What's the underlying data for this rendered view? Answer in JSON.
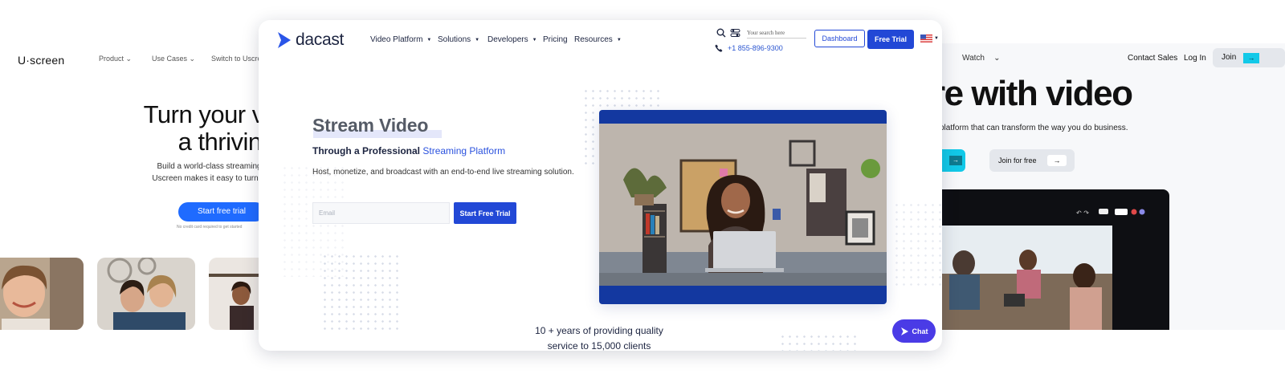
{
  "left_site": {
    "logo": "U·screen",
    "nav": [
      "Product",
      "Use Cases",
      "Switch to Uscreen"
    ],
    "headline": [
      "Turn your video",
      "a thriving"
    ],
    "description": [
      "Build a world-class streaming platform",
      "Uscreen makes it easy to turn your video"
    ],
    "cta": "Start free trial",
    "note": "No credit card required to get started"
  },
  "right_site": {
    "nav_watch": "Watch",
    "nav_right": [
      "Contact Sales",
      "Log In"
    ],
    "join": "Join",
    "headline": "re with video",
    "subheadline": "platform that can transform the way you do business.",
    "cta_primary": "ns",
    "cta_secondary": "Join for free"
  },
  "dacast": {
    "logo_text": "dacast",
    "nav": [
      {
        "label": "Video Platform",
        "dropdown": true
      },
      {
        "label": "Solutions",
        "dropdown": true
      },
      {
        "label": "Developers",
        "dropdown": true
      },
      {
        "label": "Pricing",
        "dropdown": false
      },
      {
        "label": "Resources",
        "dropdown": true
      }
    ],
    "search_placeholder": "Your search here",
    "phone": "+1 855-896-9300",
    "dashboard_button": "Dashboard",
    "free_trial_button": "Free Trial",
    "hero": {
      "title": "Stream Video",
      "subtitle_prefix": "Through a Professional",
      "subtitle_highlight": "Streaming Platform",
      "description": "Host, monetize, and broadcast with an end-to-end live streaming solution.",
      "email_placeholder": "Email",
      "cta": "Start Free Trial"
    },
    "stats": [
      "10 + years of providing quality",
      "service to 15,000 clients"
    ],
    "chat_button": "Chat",
    "colors": {
      "brand_blue": "#2248d6",
      "video_frame": "#1338a0",
      "chat_purple": "#4a3be6"
    }
  }
}
